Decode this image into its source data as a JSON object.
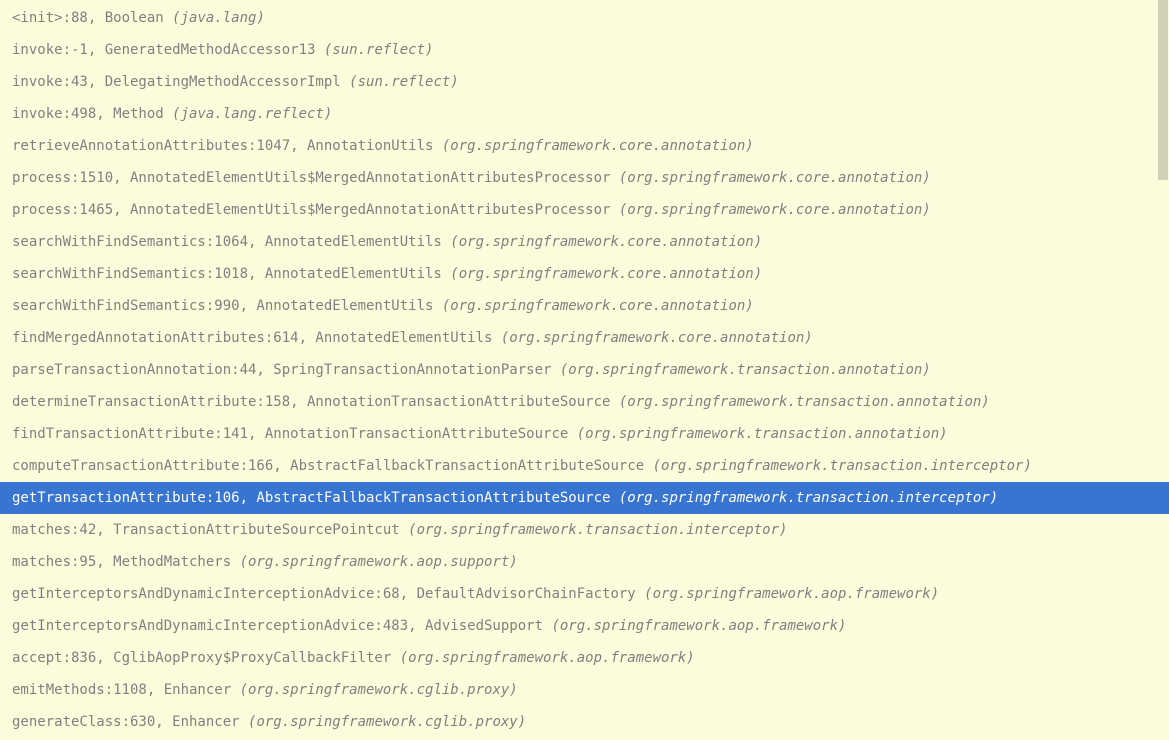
{
  "selected_index": 15,
  "frames": [
    {
      "method": "<init>:88, Boolean ",
      "package": "(java.lang)"
    },
    {
      "method": "invoke:-1, GeneratedMethodAccessor13 ",
      "package": "(sun.reflect)"
    },
    {
      "method": "invoke:43, DelegatingMethodAccessorImpl ",
      "package": "(sun.reflect)"
    },
    {
      "method": "invoke:498, Method ",
      "package": "(java.lang.reflect)"
    },
    {
      "method": "retrieveAnnotationAttributes:1047, AnnotationUtils ",
      "package": "(org.springframework.core.annotation)"
    },
    {
      "method": "process:1510, AnnotatedElementUtils$MergedAnnotationAttributesProcessor ",
      "package": "(org.springframework.core.annotation)"
    },
    {
      "method": "process:1465, AnnotatedElementUtils$MergedAnnotationAttributesProcessor ",
      "package": "(org.springframework.core.annotation)"
    },
    {
      "method": "searchWithFindSemantics:1064, AnnotatedElementUtils ",
      "package": "(org.springframework.core.annotation)"
    },
    {
      "method": "searchWithFindSemantics:1018, AnnotatedElementUtils ",
      "package": "(org.springframework.core.annotation)"
    },
    {
      "method": "searchWithFindSemantics:990, AnnotatedElementUtils ",
      "package": "(org.springframework.core.annotation)"
    },
    {
      "method": "findMergedAnnotationAttributes:614, AnnotatedElementUtils ",
      "package": "(org.springframework.core.annotation)"
    },
    {
      "method": "parseTransactionAnnotation:44, SpringTransactionAnnotationParser ",
      "package": "(org.springframework.transaction.annotation)"
    },
    {
      "method": "determineTransactionAttribute:158, AnnotationTransactionAttributeSource ",
      "package": "(org.springframework.transaction.annotation)"
    },
    {
      "method": "findTransactionAttribute:141, AnnotationTransactionAttributeSource ",
      "package": "(org.springframework.transaction.annotation)"
    },
    {
      "method": "computeTransactionAttribute:166, AbstractFallbackTransactionAttributeSource ",
      "package": "(org.springframework.transaction.interceptor)"
    },
    {
      "method": "getTransactionAttribute:106, AbstractFallbackTransactionAttributeSource ",
      "package": "(org.springframework.transaction.interceptor)"
    },
    {
      "method": "matches:42, TransactionAttributeSourcePointcut ",
      "package": "(org.springframework.transaction.interceptor)"
    },
    {
      "method": "matches:95, MethodMatchers ",
      "package": "(org.springframework.aop.support)"
    },
    {
      "method": "getInterceptorsAndDynamicInterceptionAdvice:68, DefaultAdvisorChainFactory ",
      "package": "(org.springframework.aop.framework)"
    },
    {
      "method": "getInterceptorsAndDynamicInterceptionAdvice:483, AdvisedSupport ",
      "package": "(org.springframework.aop.framework)"
    },
    {
      "method": "accept:836, CglibAopProxy$ProxyCallbackFilter ",
      "package": "(org.springframework.aop.framework)"
    },
    {
      "method": "emitMethods:1108, Enhancer ",
      "package": "(org.springframework.cglib.proxy)"
    },
    {
      "method": "generateClass:630, Enhancer ",
      "package": "(org.springframework.cglib.proxy)"
    }
  ]
}
